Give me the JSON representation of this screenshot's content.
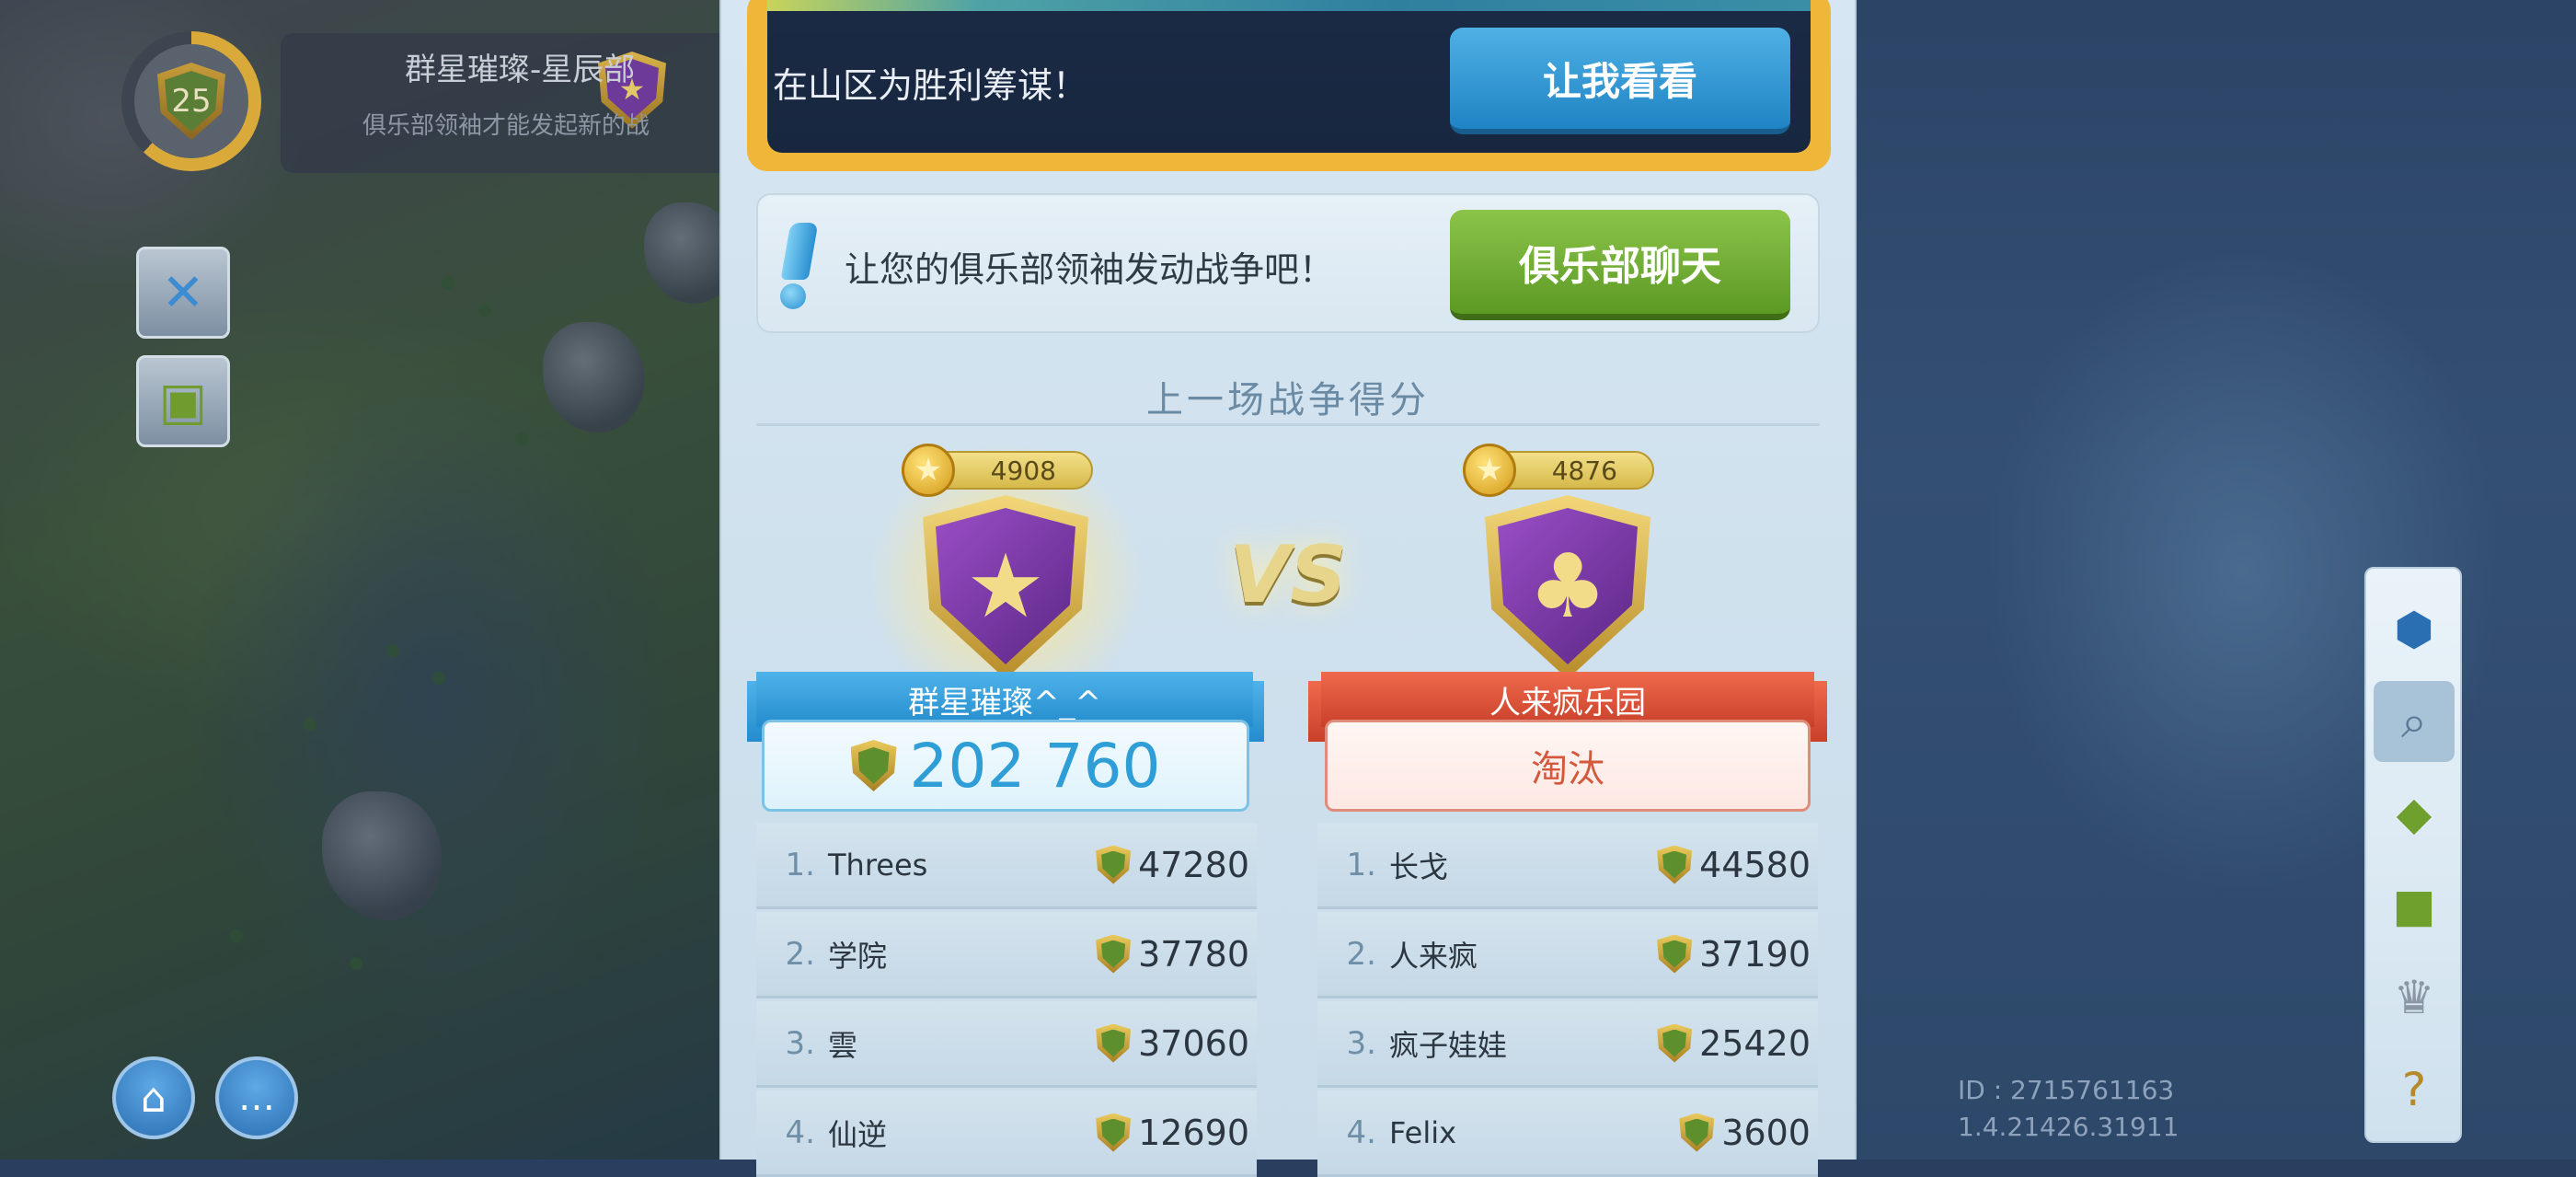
{
  "player": {
    "level": "25"
  },
  "club": {
    "name": "群星璀璨-星辰部",
    "subtitle": "俱乐部领袖才能发起新的战"
  },
  "event": {
    "text": "在山区为胜利筹谋！",
    "button": "让我看看"
  },
  "chat_prompt": {
    "text": "让您的俱乐部领袖发动战争吧！",
    "button": "俱乐部聊天"
  },
  "last_war": {
    "title": "上一场战争得分",
    "vs": "VS",
    "left_team": {
      "rating": "4908",
      "name": "群星璀璨^_^",
      "score": "202 760",
      "members": [
        {
          "rank": "1.",
          "name": "Threes",
          "points": "47280"
        },
        {
          "rank": "2.",
          "name": "学院",
          "points": "37780"
        },
        {
          "rank": "3.",
          "name": "雲",
          "points": "37060"
        },
        {
          "rank": "4.",
          "name": "仙逆",
          "points": "12690"
        }
      ]
    },
    "right_team": {
      "rating": "4876",
      "name": "人来疯乐园",
      "status": "淘汰",
      "members": [
        {
          "rank": "1.",
          "name": "长戈",
          "points": "44580"
        },
        {
          "rank": "2.",
          "name": "人来疯",
          "points": "37190"
        },
        {
          "rank": "3.",
          "name": "疯子娃娃",
          "points": "25420"
        },
        {
          "rank": "4.",
          "name": "Felix",
          "points": "3600"
        }
      ]
    }
  },
  "build": {
    "id": "ID : 2715761163",
    "version": "1.4.21426.31911"
  },
  "icons": {
    "tools": "wrench-screwdriver-icon",
    "shop": "shopping-bag-icon",
    "home": "home-icon",
    "chat": "chat-bubble-icon",
    "info": "info-hex-icon",
    "search": "magnifier-icon",
    "card_bolt": "bolt-card-icon",
    "card_star": "star-card-icon",
    "trophy": "trophy-icon",
    "help": "help-book-icon"
  },
  "colors": {
    "accent_blue": "#248ccd",
    "accent_green": "#5c9a24",
    "accent_red": "#c9402a",
    "gold": "#f0b63a",
    "panel": "#d6e6f2"
  }
}
